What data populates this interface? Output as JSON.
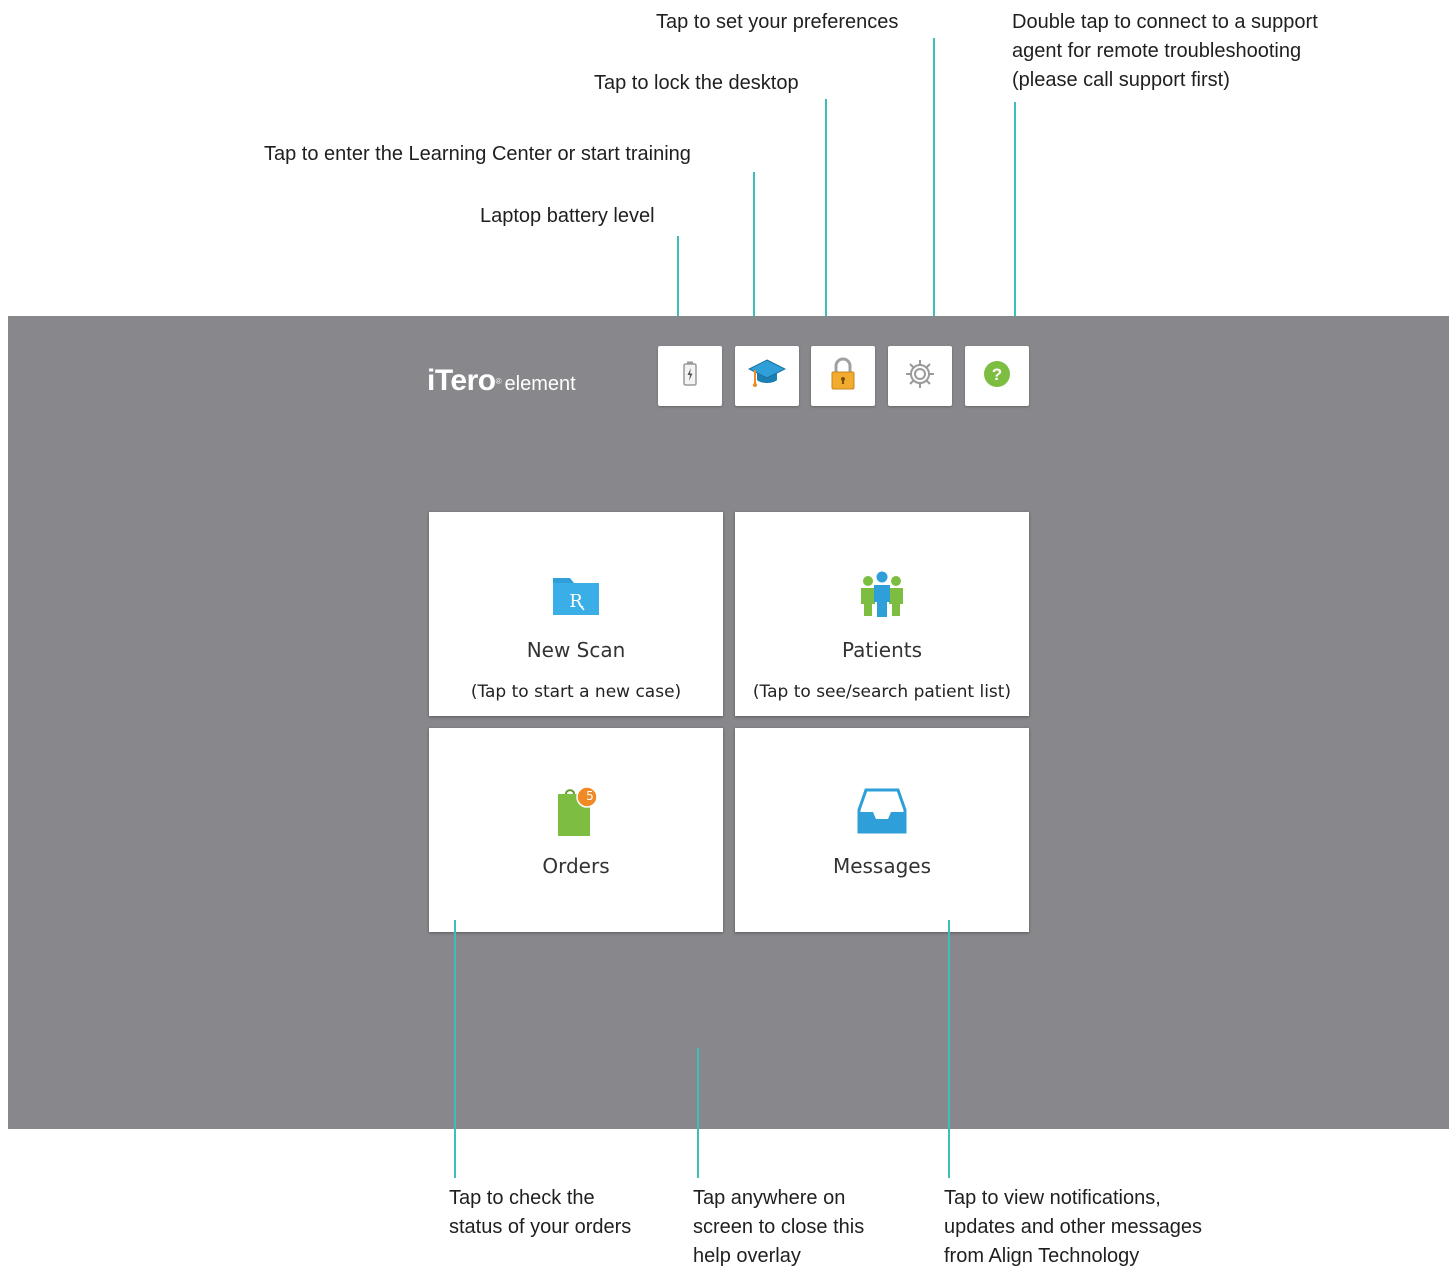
{
  "callouts": {
    "preferences": "Tap to set your preferences",
    "support": [
      "Double tap to connect to a support",
      "agent for remote troubleshooting",
      "(please call support first)"
    ],
    "lock": "Tap to lock the desktop",
    "learning": "Tap to enter the Learning Center or start training",
    "battery": "Laptop battery level",
    "orders": [
      "Tap to check the",
      "status of your orders"
    ],
    "close": [
      "Tap anywhere on",
      "screen to close this",
      "help overlay"
    ],
    "messages": [
      "Tap to view notifications,",
      "updates and other messages",
      "from Align Technology"
    ]
  },
  "header": {
    "logo_brand": "iTero",
    "logo_product": "element",
    "toolbar": [
      {
        "id": "battery",
        "icon": "battery-icon"
      },
      {
        "id": "learning",
        "icon": "graduation-cap-icon"
      },
      {
        "id": "lock",
        "icon": "lock-icon"
      },
      {
        "id": "settings",
        "icon": "gear-icon"
      },
      {
        "id": "help",
        "icon": "help-icon"
      }
    ]
  },
  "tiles": {
    "new_scan": {
      "title": "New Scan",
      "subtitle": "(Tap to start a new case)",
      "icon": "rx-folder-icon"
    },
    "patients": {
      "title": "Patients",
      "subtitle": "(Tap to see/search patient list)",
      "icon": "patients-icon"
    },
    "orders": {
      "title": "Orders",
      "badge": "5",
      "icon": "orders-clipboard-icon"
    },
    "messages": {
      "title": "Messages",
      "icon": "inbox-tray-icon"
    }
  },
  "colors": {
    "overlay_bg": "#88888c",
    "leader_line": "#3cbfb8",
    "accent_blue": "#2e9fd8",
    "accent_green": "#7cbd42",
    "badge_orange": "#f08a24"
  }
}
